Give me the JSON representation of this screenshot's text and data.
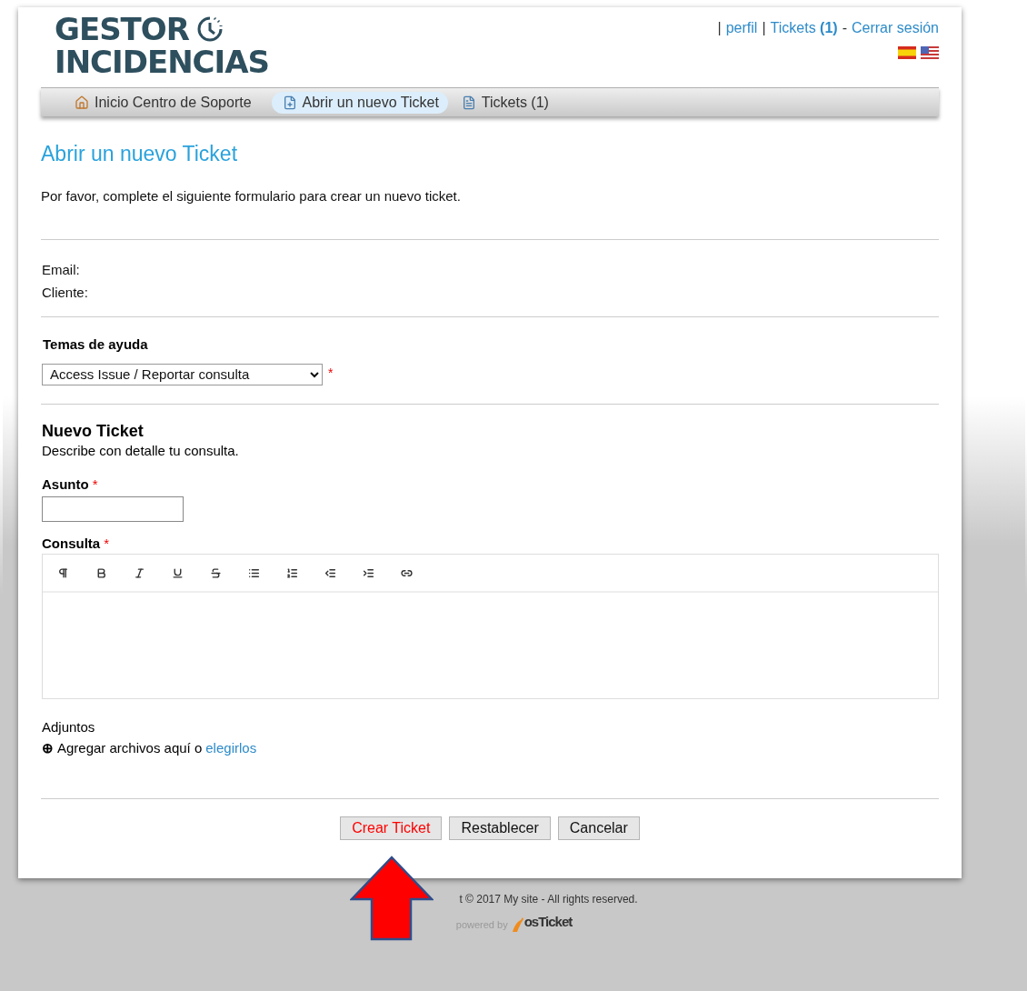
{
  "logo": {
    "line_1": "GESTOR",
    "line_2": "INCIDENCIAS"
  },
  "user_links": {
    "separator_1": "|",
    "profile": "perfil",
    "separator_2": "|",
    "tickets": "Tickets",
    "tickets_count": "(1)",
    "separator_3": "-",
    "logout": "Cerrar sesión"
  },
  "nav": [
    {
      "label": "Inicio Centro de Soporte",
      "selected": false
    },
    {
      "label": "Abrir un nuevo Ticket",
      "selected": true
    },
    {
      "label": "Tickets (1)",
      "selected": false
    }
  ],
  "page_title": "Abrir un nuevo Ticket",
  "intro": "Por favor, complete el siguiente formulario para crear un nuevo ticket.",
  "user_info": [
    {
      "label": "Email:"
    },
    {
      "label": "Cliente:"
    }
  ],
  "help_topic": {
    "label": "Temas de ayuda",
    "value": "Access Issue / Reportar consulta",
    "required": "*"
  },
  "section": {
    "title": "Nuevo Ticket",
    "subtitle": "Describe con detalle tu consulta."
  },
  "subject": {
    "label": "Asunto",
    "required": "*"
  },
  "message": {
    "label": "Consulta",
    "required": "*"
  },
  "attachments": {
    "label": "Adjuntos",
    "icon": "⊕",
    "text": "Agregar archivos aquí o",
    "link": "elegirlos"
  },
  "buttons": [
    {
      "label": "Crear Ticket",
      "kind": "primary"
    },
    {
      "label": "Restablecer",
      "kind": "normal"
    },
    {
      "label": "Cancelar",
      "kind": "normal"
    }
  ],
  "footer": {
    "copyright": "t © 2017 My site - All rights reserved.",
    "powered_by": "powered by",
    "brand": "osTicket"
  }
}
